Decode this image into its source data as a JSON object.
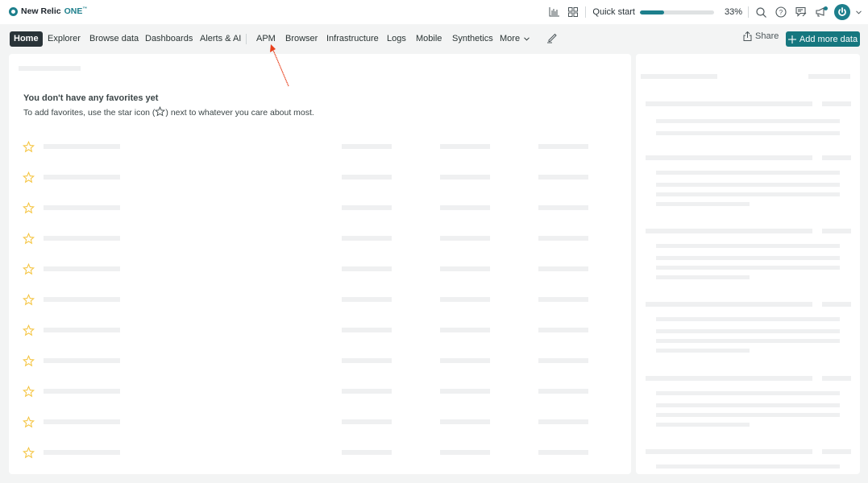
{
  "app": {
    "brand_name": "New Relic",
    "brand_suffix": "ONE",
    "brand_tm": "™"
  },
  "topbar": {
    "icons": [
      "bar-chart-icon",
      "apps-grid-icon",
      "search-icon",
      "help-icon",
      "feedback-icon",
      "announcements-icon",
      "user-avatar-icon",
      "chevron-down-icon"
    ],
    "quick_start_label": "Quick start",
    "quick_start_progress": 33,
    "quick_start_pct_label": "33%",
    "accent_color": "#1d7f8c",
    "notification_dot": true
  },
  "nav": {
    "items": [
      {
        "label": "Home",
        "active": true
      },
      {
        "label": "Explorer",
        "active": false
      },
      {
        "label": "Browse data",
        "active": false
      },
      {
        "label": "Dashboards",
        "active": false
      },
      {
        "label": "Alerts & AI",
        "active": false
      },
      {
        "label": "APM",
        "active": false
      },
      {
        "label": "Browser",
        "active": false
      },
      {
        "label": "Infrastructure",
        "active": false
      },
      {
        "label": "Logs",
        "active": false
      },
      {
        "label": "Mobile",
        "active": false
      },
      {
        "label": "Synthetics",
        "active": false
      },
      {
        "label": "More",
        "active": false
      }
    ],
    "edit_icon": "pencil-icon",
    "share_label": "Share",
    "add_data_label": "Add more data",
    "add_data_color": "#16777f"
  },
  "favorites": {
    "empty_title": "You don't have any favorites yet",
    "empty_desc_before": "To add favorites, use the star icon (",
    "empty_desc_after": ") next to whatever you care about most.",
    "star_color": "#f5c542",
    "placeholder_rows": 11
  },
  "annotation": {
    "arrow_target": "APM",
    "arrow_color": "#e8401c"
  }
}
